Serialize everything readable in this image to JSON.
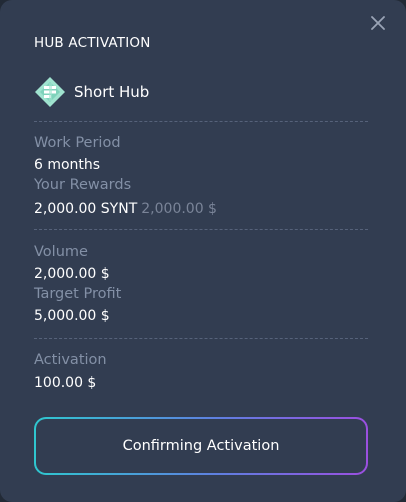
{
  "modal": {
    "title": "HUB ACTIVATION",
    "hub": {
      "name": "Short Hub",
      "logo_icon": "short-hub-logo-icon",
      "logo_color": "#9fe3cf"
    },
    "close_icon": "close-icon",
    "work_period": {
      "label": "Work Period",
      "value": "6 months"
    },
    "rewards": {
      "label": "Your Rewards",
      "value": "2,000.00 SYNT",
      "value_usd": "2,000.00 $"
    },
    "volume": {
      "label": "Volume",
      "value": "2,000.00 $"
    },
    "target_profit": {
      "label": "Target Profit",
      "value": "5,000.00 $"
    },
    "activation": {
      "label": "Activation",
      "value": "100.00 $"
    },
    "confirm_button": {
      "label": "Confirming Activation"
    },
    "colors": {
      "background": "#323d51",
      "button_gradient_start": "#2fc7cf",
      "button_gradient_end": "#9b4fe0"
    }
  }
}
